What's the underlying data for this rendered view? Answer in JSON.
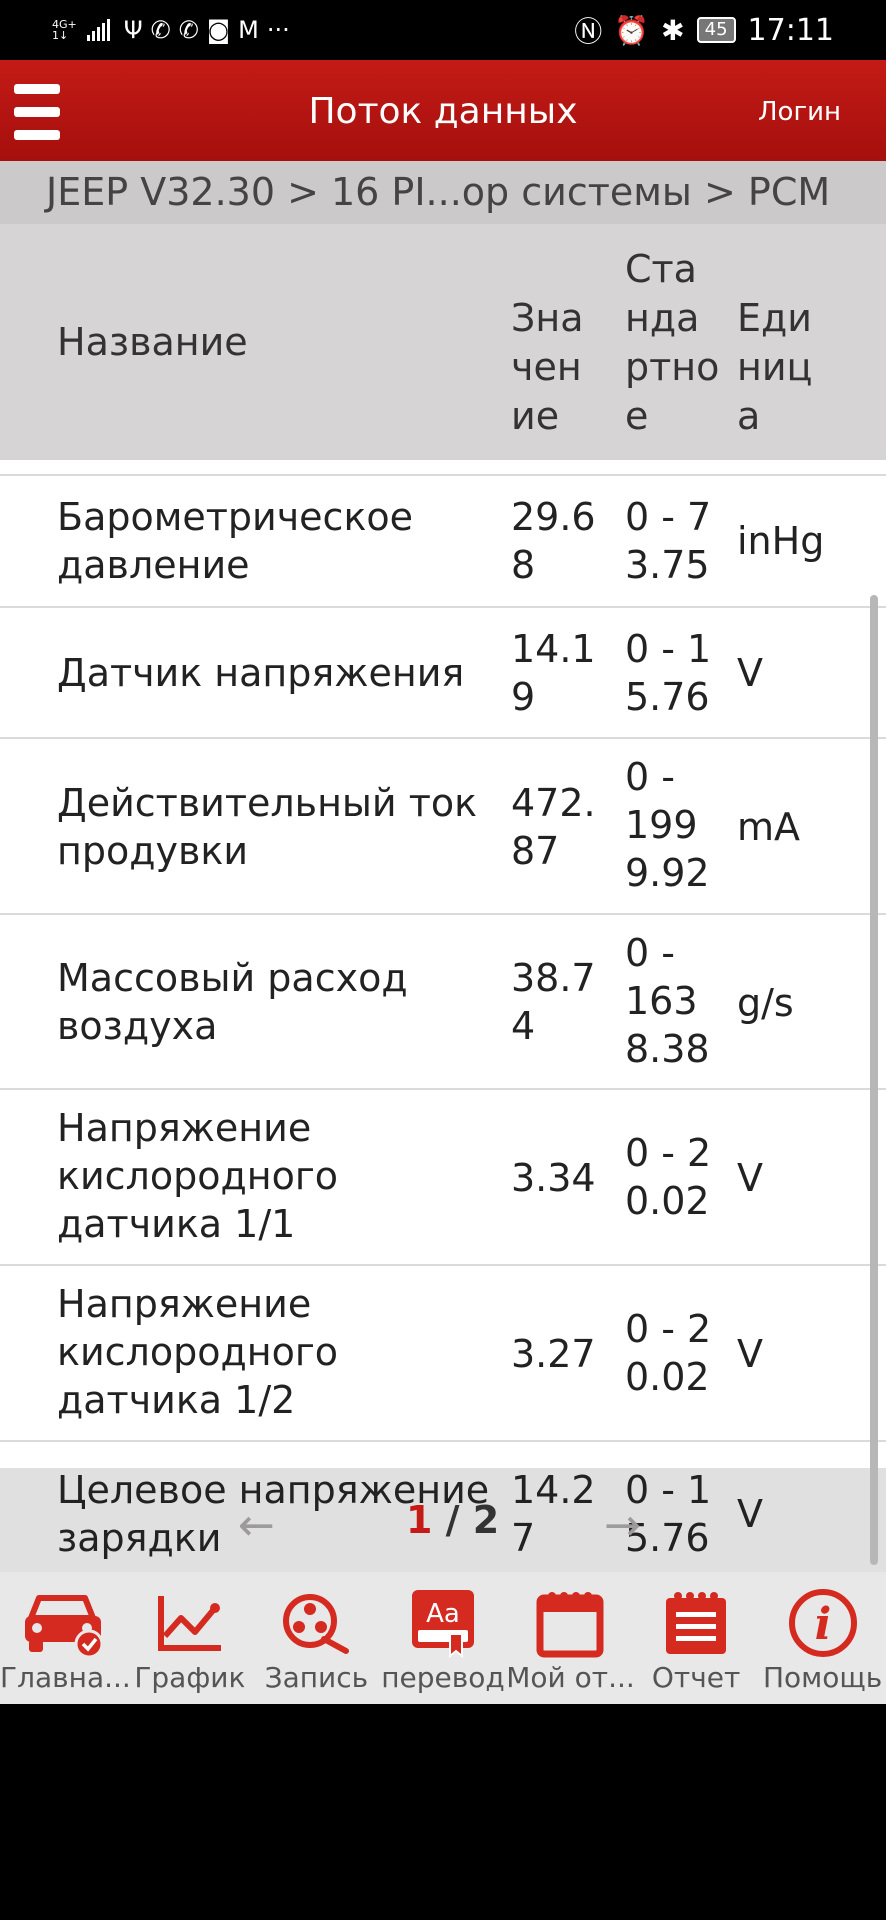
{
  "status_bar": {
    "network": "4G+",
    "network_sub": "1↓",
    "icons": [
      "usb-icon",
      "viber-icon",
      "viber-icon",
      "instagram-icon",
      "gmail-icon",
      "more-icon"
    ],
    "more": "···",
    "right_icons": [
      "nfc-icon",
      "alarm-icon",
      "bluetooth-icon"
    ],
    "battery": "45",
    "time": "17:11"
  },
  "header": {
    "title": "Поток данных",
    "login": "Логин",
    "color": "#b31512"
  },
  "breadcrumb": "JEEP V32.30 > 16 PI...ор системы > PCM",
  "table": {
    "columns": {
      "name": "Название",
      "value": [
        "Зна",
        "чен",
        "ие"
      ],
      "standard": [
        "Ста",
        "нда",
        "ртно",
        "е"
      ],
      "unit": [
        "Еди",
        "ниц",
        "а"
      ]
    },
    "rows": [
      {
        "name": [
          "Барометрическое",
          "давление"
        ],
        "value": [
          "29.6",
          "8"
        ],
        "standard": [
          "0 - 7",
          "3.75"
        ],
        "unit": "inHg"
      },
      {
        "name": [
          "Датчик напряжения"
        ],
        "value": [
          "14.1",
          "9"
        ],
        "standard": [
          "0 - 1",
          "5.76"
        ],
        "unit": "V"
      },
      {
        "name": [
          "Действительный ток",
          "продувки"
        ],
        "value": [
          "472.",
          "87"
        ],
        "standard": [
          "0 -",
          "199",
          "9.92"
        ],
        "unit": "mA"
      },
      {
        "name": [
          "Массовый расход",
          "воздуха"
        ],
        "value": [
          "38.7",
          "4"
        ],
        "standard": [
          "0 -",
          "163",
          "8.38"
        ],
        "unit": "g/s"
      },
      {
        "name": [
          "Напряжение",
          "кислородного",
          "датчика 1/1"
        ],
        "value": [
          "3.34"
        ],
        "standard": [
          "0 - 2",
          "0.02"
        ],
        "unit": "V"
      },
      {
        "name": [
          "Напряжение",
          "кислородного",
          "датчика 1/2"
        ],
        "value": [
          "3.27"
        ],
        "standard": [
          "0 - 2",
          "0.02"
        ],
        "unit": "V"
      },
      {
        "name": [
          "Целевое напряжение",
          "зарядки"
        ],
        "value": [
          "14.2",
          "7"
        ],
        "standard": [
          "0 - 1",
          "5.76"
        ],
        "unit": "V"
      }
    ]
  },
  "pagination": {
    "current": "1",
    "separator": " / ",
    "total": "2",
    "prev": "←",
    "next": "→"
  },
  "bottom_nav": [
    {
      "label": "Главна...",
      "icon": "car-icon"
    },
    {
      "label": "График",
      "icon": "chart-icon"
    },
    {
      "label": "Запись",
      "icon": "film-reel-icon"
    },
    {
      "label": "перевод",
      "icon": "translate-icon",
      "icon_text": "Aa"
    },
    {
      "label": "Мой от...",
      "icon": "calendar-icon"
    },
    {
      "label": "Отчет",
      "icon": "report-icon"
    },
    {
      "label": "Помощь",
      "icon": "info-icon",
      "icon_text": "i"
    }
  ],
  "accent_color": "#d42a20"
}
